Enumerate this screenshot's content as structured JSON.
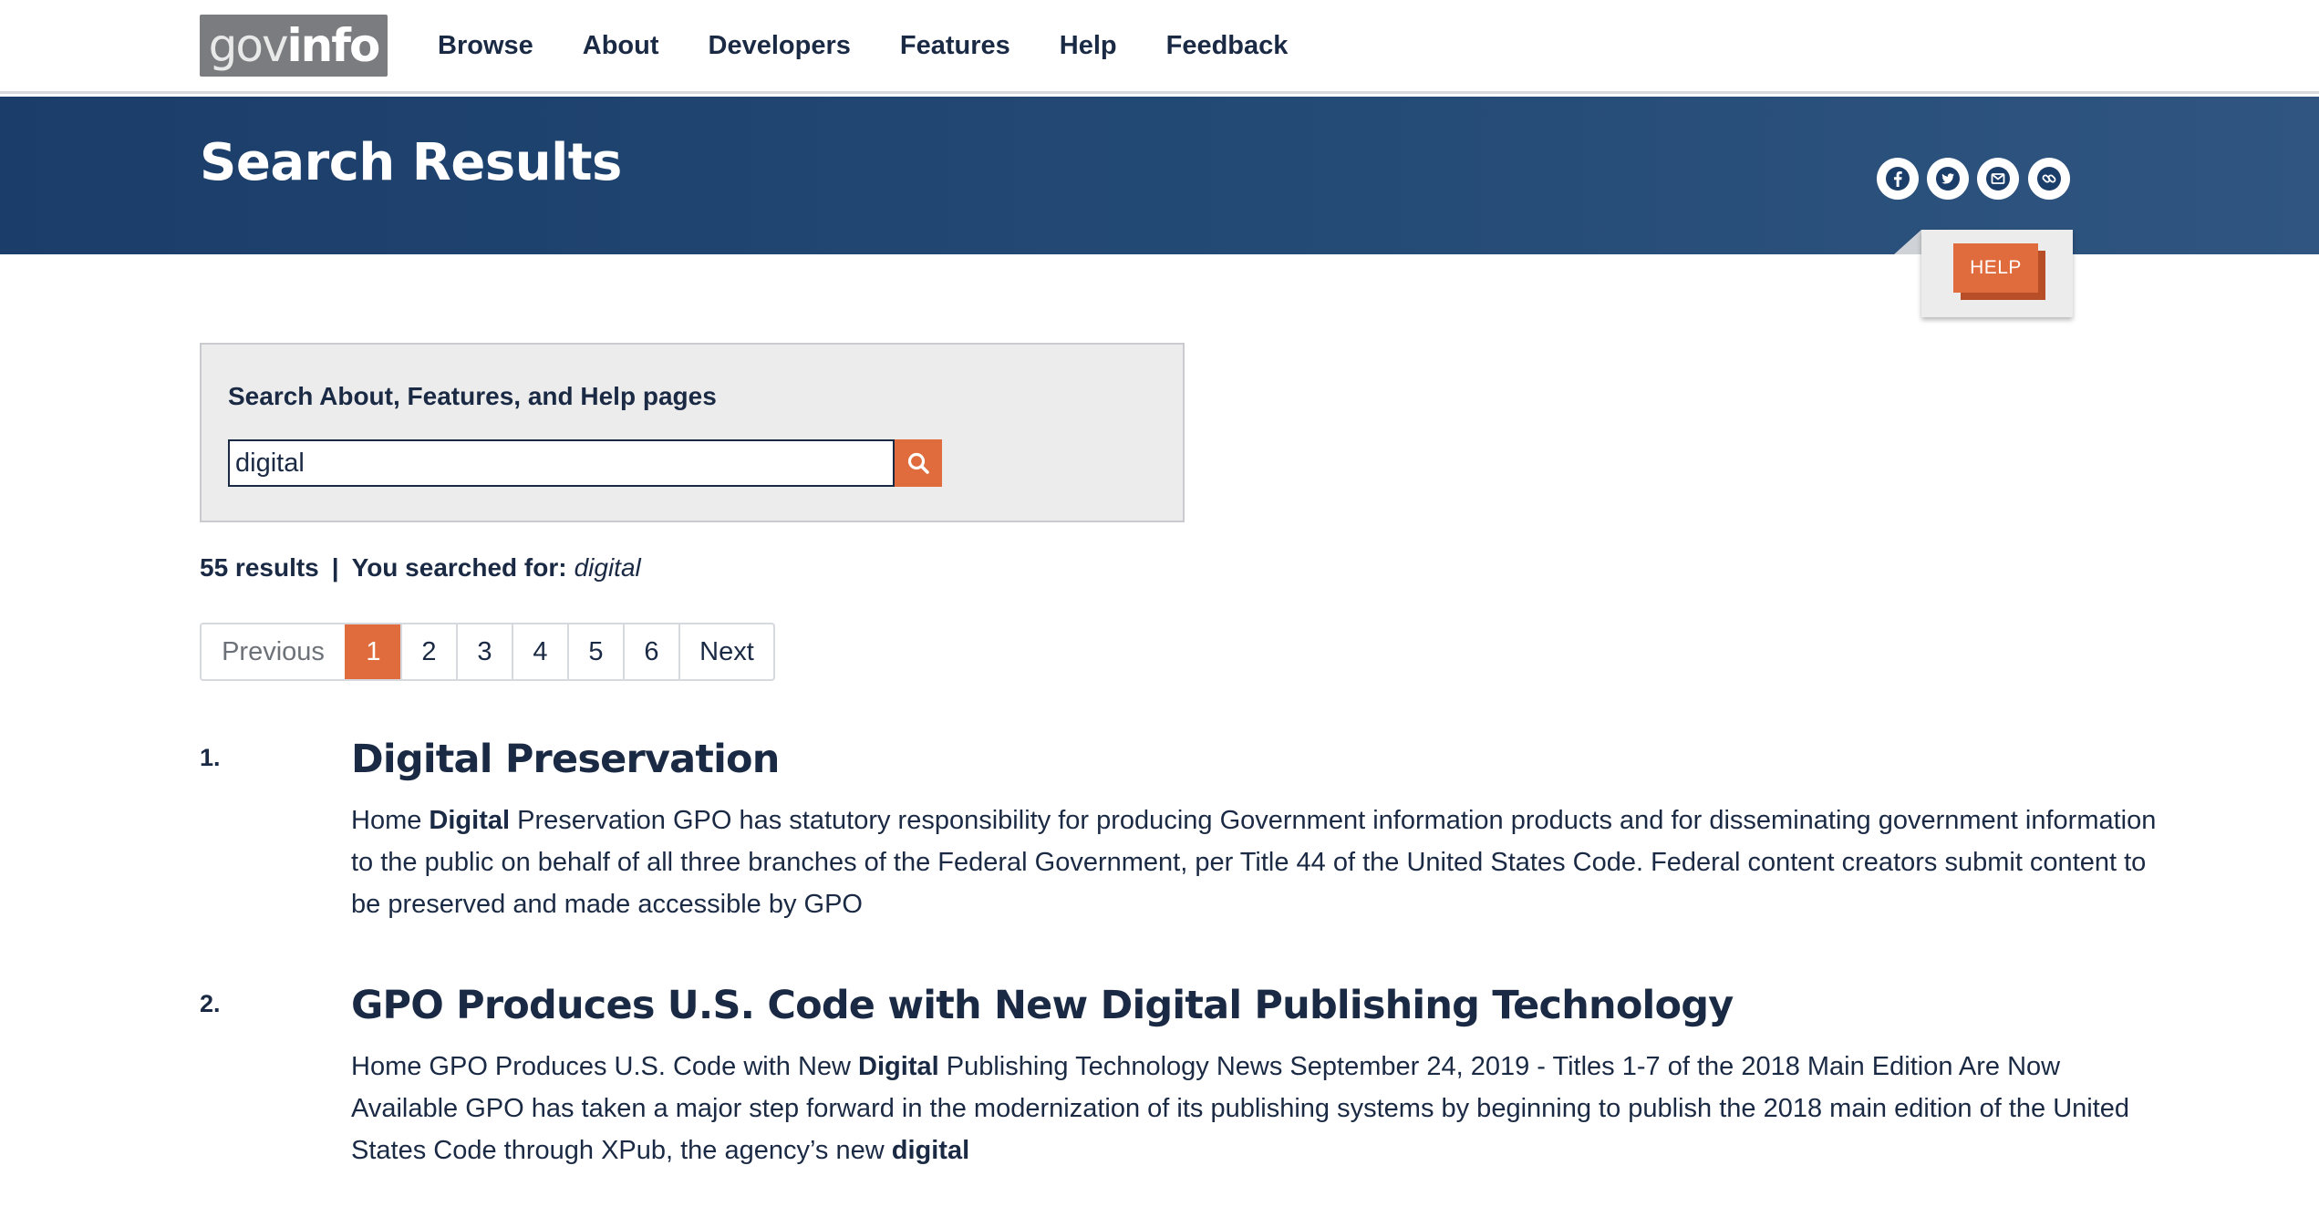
{
  "logo": {
    "part1": "gov",
    "part2": "info"
  },
  "nav": [
    "Browse",
    "About",
    "Developers",
    "Features",
    "Help",
    "Feedback"
  ],
  "banner": {
    "title": "Search Results",
    "social_icons": [
      "facebook-icon",
      "twitter-icon",
      "email-icon",
      "link-icon"
    ]
  },
  "help": {
    "label": "HELP"
  },
  "search": {
    "label": "Search About, Features, and Help pages",
    "value": "digital",
    "button_icon": "search-icon"
  },
  "summary": {
    "count": "55 results",
    "separator": "|",
    "label": "You searched for:",
    "query": "digital"
  },
  "pagination": {
    "previous": "Previous",
    "pages": [
      "1",
      "2",
      "3",
      "4",
      "5",
      "6"
    ],
    "current": "1",
    "next": "Next"
  },
  "results": [
    {
      "number": "1.",
      "title": "Digital Preservation",
      "snippet": [
        {
          "t": "Home ",
          "b": false
        },
        {
          "t": "Digital",
          "b": true
        },
        {
          "t": " Preservation GPO has statutory responsibility for producing Government information products and for disseminating government information to the public on behalf of all three branches of the Federal Government, per Title 44 of the United States Code. Federal content creators submit content to be preserved and made accessible by GPO",
          "b": false
        }
      ]
    },
    {
      "number": "2.",
      "title": "GPO Produces U.S. Code with New Digital Publishing Technology",
      "snippet": [
        {
          "t": "Home GPO Produces U.S. Code with New ",
          "b": false
        },
        {
          "t": "Digital",
          "b": true
        },
        {
          "t": " Publishing Technology News September 24, 2019 - Titles 1-7 of the 2018 Main Edition Are Now Available GPO has taken a major step forward in the modernization of its publishing systems by beginning to publish the 2018 main edition of the United States Code through XPub, the agency’s new ",
          "b": false
        },
        {
          "t": "digital",
          "b": true
        }
      ]
    }
  ],
  "colors": {
    "navy": "#1b2a44",
    "banner": "#1b3d69",
    "accent": "#e06b3c",
    "panel": "#ececec"
  }
}
